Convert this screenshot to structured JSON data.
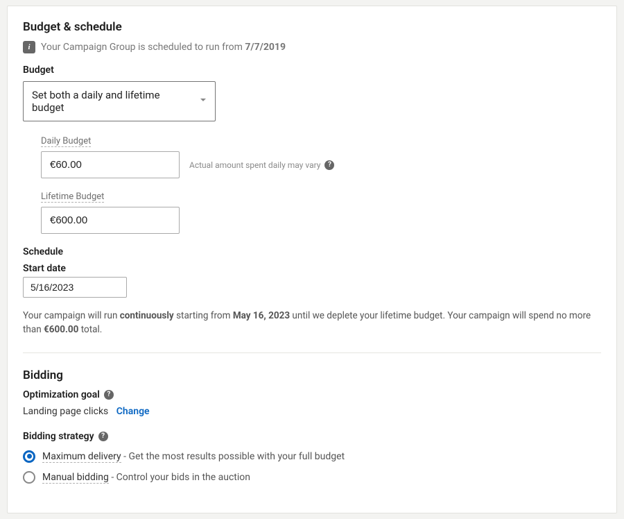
{
  "budget_section": {
    "title": "Budget & schedule",
    "info_text": "Your Campaign Group is scheduled to run from ",
    "info_date": "7/7/2019"
  },
  "budget": {
    "label": "Budget",
    "selected_option": "Set both a daily and lifetime budget"
  },
  "daily_budget": {
    "label": "Daily Budget",
    "value": "€60.00",
    "hint": "Actual amount spent daily may vary"
  },
  "lifetime_budget": {
    "label": "Lifetime Budget",
    "value": "€600.00"
  },
  "schedule": {
    "label": "Schedule",
    "start_date_label": "Start date",
    "start_date_value": "5/16/2023"
  },
  "summary": {
    "p1": "Your campaign will run ",
    "p1_bold": "continuously",
    "p2": " starting from ",
    "p2_bold": "May 16, 2023",
    "p3": " until we deplete your lifetime budget. Your campaign will spend no more than ",
    "p3_bold": "€600.00",
    "p4": " total."
  },
  "bidding": {
    "title": "Bidding",
    "opt_goal_label": "Optimization goal",
    "opt_goal_value": "Landing page clicks",
    "change_label": "Change",
    "strategy_label": "Bidding strategy",
    "options": [
      {
        "name": "Maximum delivery",
        "desc": " - Get the most results possible with your full budget",
        "selected": true
      },
      {
        "name": "Manual bidding",
        "desc": " - Control your bids in the auction",
        "selected": false
      }
    ]
  }
}
